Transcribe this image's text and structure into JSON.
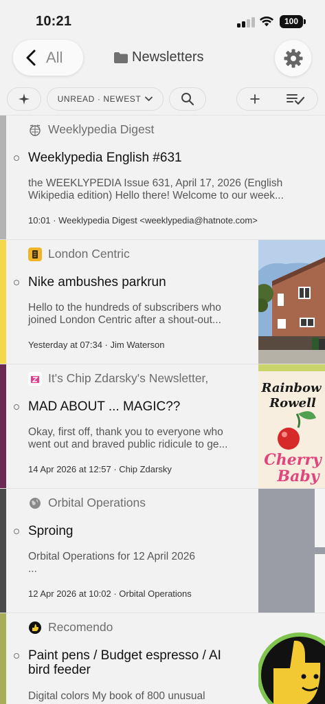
{
  "status": {
    "time": "10:21",
    "battery": "100"
  },
  "nav": {
    "back_label": "All",
    "title": "Newsletters"
  },
  "toolbar": {
    "sort_label": "UNREAD · NEWEST"
  },
  "items": [
    {
      "source": "Weeklypedia Digest",
      "title": "Weeklypedia English #631",
      "snippet_line1": "the WEEKLYPEDIA Issue 631, April 17, 2026 (English",
      "snippet_line2": "Wikipedia edition) Hello there! Welcome to our week...",
      "meta": "10:01 · Weeklypedia Digest <weeklypedia@hatnote.com>",
      "bar_color": "#b3b3b3"
    },
    {
      "source": "London Centric",
      "title": "Nike ambushes parkrun",
      "snippet_line1": "Hello to the hundreds of subscribers who",
      "snippet_line2": "joined London Centric after a shout-out...",
      "meta": "Yesterday at 07:34 · Jim Waterson",
      "bar_color": "#f5d84a"
    },
    {
      "source": "It's Chip Zdarsky's Newsletter,",
      "title": "MAD ABOUT ... MAGIC??",
      "snippet_line1": "Okay, first off, thank you to everyone who",
      "snippet_line2": "went out and braved public ridicule to ge...",
      "meta": "14 Apr 2026 at 12:57 · Chip Zdarsky",
      "bar_color": "#6b2a55",
      "thumb_text": [
        "Rainbow",
        "Rowell",
        "Cherry",
        "Baby"
      ]
    },
    {
      "source": "Orbital Operations",
      "title": "Sproing",
      "snippet_line1": "Orbital Operations for 12 April 2026",
      "snippet_line2": "...",
      "meta": "12 Apr 2026 at 10:02 · Orbital Operations",
      "bar_color": "#4a4a4a"
    },
    {
      "source": "Recomendo",
      "title_line1": "Paint pens / Budget espresso / AI",
      "title_line2": "bird feeder",
      "snippet_line1": "Digital colors My book of 800 unusual",
      "bar_color": "#a7ae57"
    }
  ]
}
